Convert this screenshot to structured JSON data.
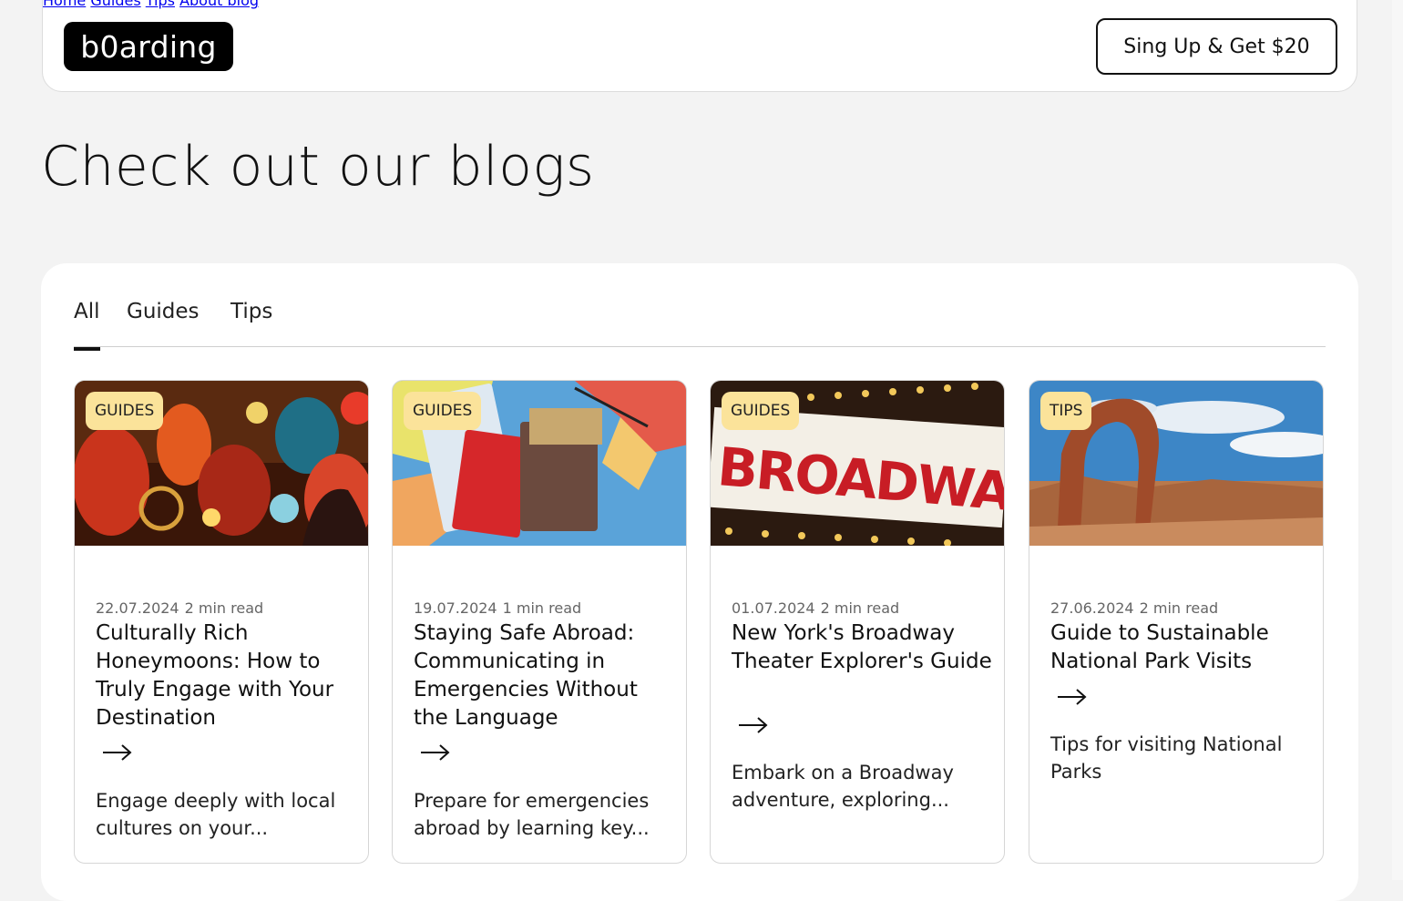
{
  "header": {
    "logo": "b0arding",
    "nav": [
      {
        "label": "Home"
      },
      {
        "label": "Guides"
      },
      {
        "label": "Tips"
      },
      {
        "label": "About blog"
      }
    ],
    "cta_label": "Sing Up & Get $20"
  },
  "page": {
    "title": "Check out our blogs"
  },
  "filter_tabs": [
    {
      "label": "All",
      "active": true
    },
    {
      "label": "Guides",
      "active": false
    },
    {
      "label": "Tips",
      "active": false
    }
  ],
  "cards": [
    {
      "category": "GUIDES",
      "date": "22.07.2024",
      "read_time": "2 min read",
      "title": "Culturally Rich Honeymoons: How to Truly Engage with Your Destination",
      "excerpt": "Engage deeply with local cultures on your...",
      "image": "market-lanterns"
    },
    {
      "category": "GUIDES",
      "date": "19.07.2024",
      "read_time": "1 min read",
      "title": "Staying Safe Abroad: Communicating in Emergencies Without the Language",
      "excerpt": "Prepare for emergencies abroad by learning key...",
      "image": "passports-map"
    },
    {
      "category": "GUIDES",
      "date": "01.07.2024",
      "read_time": "2 min read",
      "title": "New York's Broadway Theater Explorer's Guide",
      "excerpt": "Embark on a Broadway adventure, exploring...",
      "image": "broadway-sign",
      "image_text": "BROADWAY"
    },
    {
      "category": "TIPS",
      "date": "27.06.2024",
      "read_time": "2 min read",
      "title": "Guide to Sustainable National Park Visits",
      "excerpt": "Tips for visiting National Parks",
      "image": "desert-arch"
    }
  ]
}
